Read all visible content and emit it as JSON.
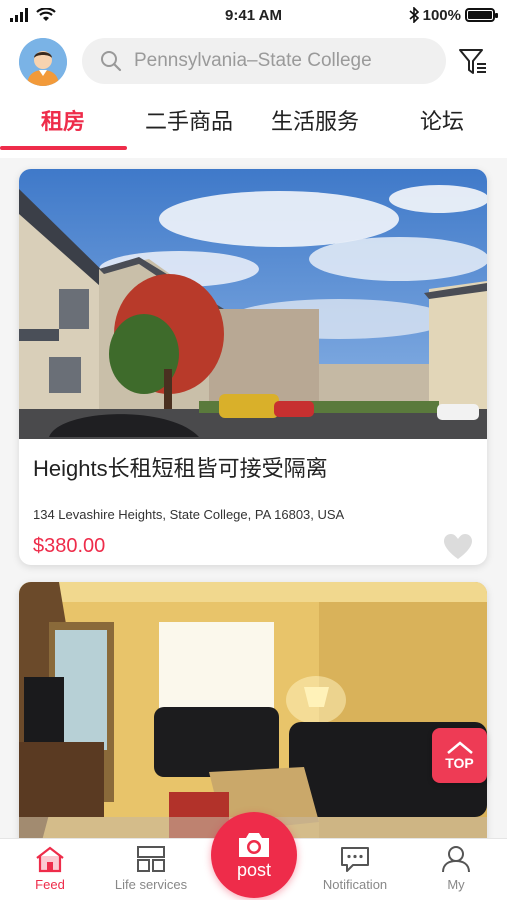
{
  "status_bar": {
    "time": "9:41 AM",
    "battery": "100%",
    "battery_level": 1.0
  },
  "search": {
    "placeholder": "Pennsylvania–State College"
  },
  "tabs": [
    {
      "label": "租房",
      "active": true
    },
    {
      "label": "二手商品",
      "active": false
    },
    {
      "label": "生活服务",
      "active": false
    },
    {
      "label": "论坛",
      "active": false
    }
  ],
  "listings": [
    {
      "title": "Heights长租短租皆可接受隔离",
      "address": "134 Levashire Heights, State College, PA 16803, USA",
      "price": "$380.00"
    },
    {
      "title": "",
      "address": "",
      "price": ""
    }
  ],
  "top_button": {
    "label": "TOP"
  },
  "bottom_nav": {
    "feed": "Feed",
    "life_services": "Life services",
    "post": "post",
    "notification": "Notification",
    "my": "My"
  },
  "colors": {
    "accent": "#ee2c4a",
    "search_bg": "#f0f0f0",
    "inactive": "#888888"
  }
}
